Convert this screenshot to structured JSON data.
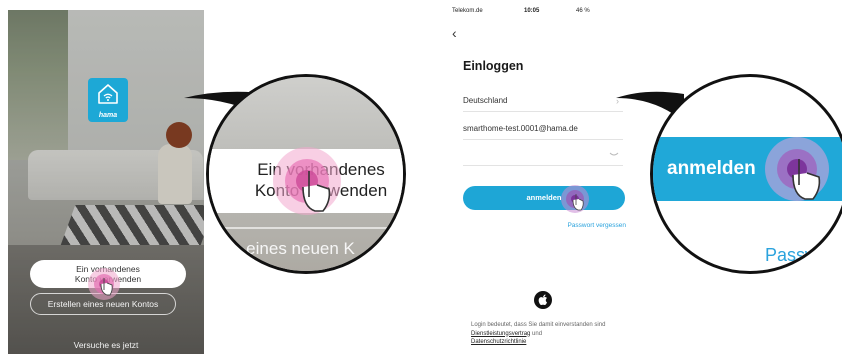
{
  "left_screen": {
    "brand": "hama",
    "existing_account_line1": "Ein vorhandenes",
    "existing_account_line2": "Konto verwenden",
    "create_account": "Erstellen eines neuen Kontos",
    "try_now": "Versuche es jetzt"
  },
  "magnifier_left": {
    "line1": "Ein vorhandenes",
    "line2": "Konto verwenden",
    "partial_create": "llen eines neuen K"
  },
  "right_screen": {
    "status": {
      "carrier": "Telekom.de",
      "time": "10:05",
      "battery": "46 %"
    },
    "back": "‹",
    "title": "Einloggen",
    "country": "Deutschland",
    "email": "smarthome-test.0001@hama.de",
    "login_button": "anmelden",
    "forgot_password": "Passwort vergessen",
    "legal_text": "Login bedeutet, dass Sie damit einverstanden sind",
    "terms_link": "Dienstleistungsvertrag",
    "and": "und",
    "privacy_link": "Datenschutzrichtlinie"
  },
  "magnifier_right": {
    "button_text": "anmelden",
    "partial_forgot": "Passw"
  },
  "colors": {
    "brand_blue": "#1da8d6",
    "link_blue": "#2ba3dd",
    "tap_pink": "#e87bb8",
    "tap_purple": "#8a3fa6"
  },
  "icons": [
    "wifi-home-icon",
    "tap-hand-icon",
    "chevron-right-icon",
    "eye-closed-icon",
    "apple-icon",
    "back-chevron-icon"
  ]
}
